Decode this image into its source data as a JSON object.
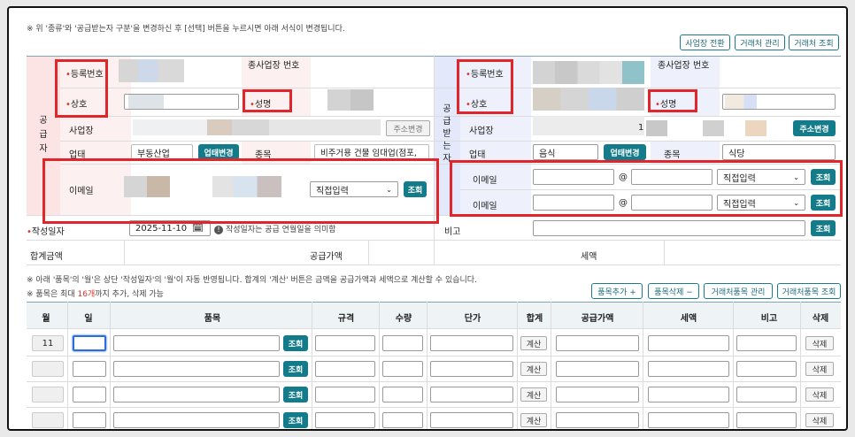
{
  "notes": {
    "top": "※ 위 '종류'와 '공급받는자 구분'을 변경하신 후 [선택] 버튼을 누르시면 아래 서식이 변경됩니다.",
    "items1": "※ 아래 '품목'의 '월'은 상단 '작성일자'의 '월'이 자동 반영됩니다. 합계의 '계산' 버튼은 금액을 공급가액과 세액으로 계산할 수 있습니다.",
    "items2_pre": "※ 품목은 최대 ",
    "items2_count": "16개",
    "items2_post": "까지 추가, 삭제 가능"
  },
  "top_buttons": [
    "사업장 전환",
    "거래처 관리",
    "거래처 조회"
  ],
  "supplier": {
    "side_label": "공급자",
    "reg_no": "등록번호",
    "sub_biz": "종사업장 번호",
    "name": "상호",
    "person": "성명",
    "address": "사업장",
    "address_btn": "주소변경",
    "business_type": "업태",
    "business_type_value": "부동산업",
    "business_btn": "업태변경",
    "item_label": "종목",
    "item_value": "비주거용 건물 임대업(점포,",
    "email": "이메일",
    "email_select": "직접입력",
    "lookup": "조회"
  },
  "receiver": {
    "side_label": "공급받는자",
    "reg_no": "등록번호",
    "sub_biz": "종사업장 번호",
    "name": "상호",
    "person": "성명",
    "address": "사업장",
    "address_suffix": "1",
    "address_btn": "주소변경",
    "business_type": "업태",
    "business_type_value": "음식",
    "business_btn": "업태변경",
    "item_label": "종목",
    "item_value": "식당",
    "email": "이메일",
    "at": "@",
    "email_select": "직접입력",
    "lookup": "조회"
  },
  "date_row": {
    "label": "작성일자",
    "value": "2025-11-10",
    "hint": "작성일자는 공급 연월일을 의미함",
    "remark": "비고",
    "lookup": "조회"
  },
  "totals": {
    "total": "합계금액",
    "supply": "공급가액",
    "tax": "세액"
  },
  "item_buttons": [
    "품목추가 +",
    "품목삭제 −",
    "거래처품목 관리",
    "거래처품목 조회"
  ],
  "columns": [
    "월",
    "일",
    "품목",
    "규격",
    "수량",
    "단가",
    "합계",
    "공급가액",
    "세액",
    "비고",
    "삭제"
  ],
  "rows": [
    {
      "month": "11",
      "lookup": "조회",
      "calc": "계산",
      "delete": "삭제"
    },
    {
      "month": "",
      "lookup": "조회",
      "calc": "계산",
      "delete": "삭제"
    },
    {
      "month": "",
      "lookup": "조회",
      "calc": "계산",
      "delete": "삭제"
    },
    {
      "month": "",
      "lookup": "조회",
      "calc": "계산",
      "delete": "삭제"
    }
  ]
}
